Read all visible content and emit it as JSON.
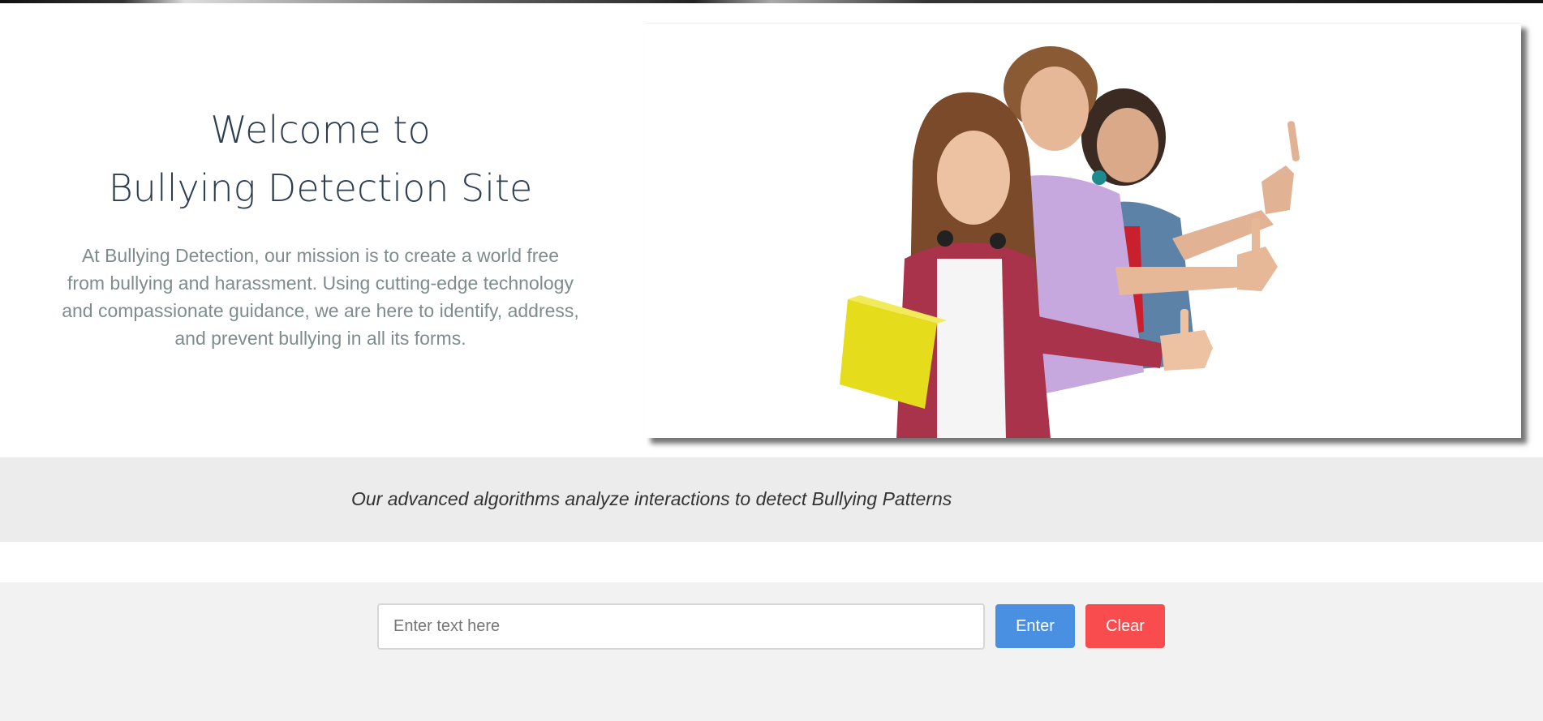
{
  "hero": {
    "title_line1": "Welcome to",
    "title_line2": "Bullying Detection Site",
    "description": "At Bullying Detection, our mission is to create a world free from bullying and harassment. Using cutting-edge technology and compassionate guidance, we are here to identify, address, and prevent bullying in all its forms.",
    "image_icon": "students-thumbs-up-photo"
  },
  "banner": {
    "text": "Our advanced algorithms analyze interactions to detect Bullying Patterns"
  },
  "form": {
    "input_placeholder": "Enter text here",
    "input_value": "",
    "enter_label": "Enter",
    "clear_label": "Clear"
  },
  "colors": {
    "title": "#2c3e50",
    "description": "#7f8c8d",
    "enter_button": "#4a90e2",
    "clear_button": "#f84c4f",
    "banner_bg": "#ececec",
    "form_bg": "#f2f2f2"
  }
}
